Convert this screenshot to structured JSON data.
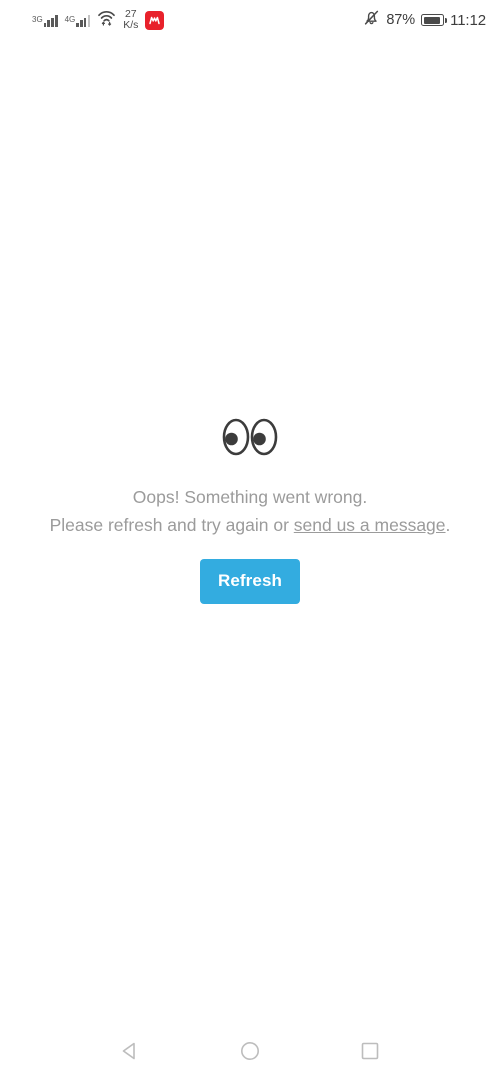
{
  "status_bar": {
    "network_1": {
      "generation": "3G",
      "icon": "signal-bars-icon"
    },
    "network_2": {
      "generation": "4G",
      "icon": "signal-bars-icon"
    },
    "wifi": {
      "icon": "wifi-transfer-icon"
    },
    "network_speed": {
      "value": "27",
      "unit": "K/s"
    },
    "notification_app": {
      "icon": "red-app-badge-icon"
    },
    "silent_mode": {
      "icon": "bell-muted-icon"
    },
    "battery_percent": "87%",
    "battery": {
      "icon": "battery-icon",
      "level": 87
    },
    "clock": "11:12"
  },
  "error": {
    "emoji": "eyes-emoji",
    "headline": "Oops! Something went wrong.",
    "body_prefix": "Please refresh and try again or ",
    "link_text": "send us a message",
    "body_suffix": ".",
    "refresh_label": "Refresh",
    "accent_color": "#33ace0",
    "text_color": "#9b9b9b"
  },
  "nav_bar": {
    "back_label": "Back",
    "home_label": "Home",
    "recents_label": "Recents"
  }
}
